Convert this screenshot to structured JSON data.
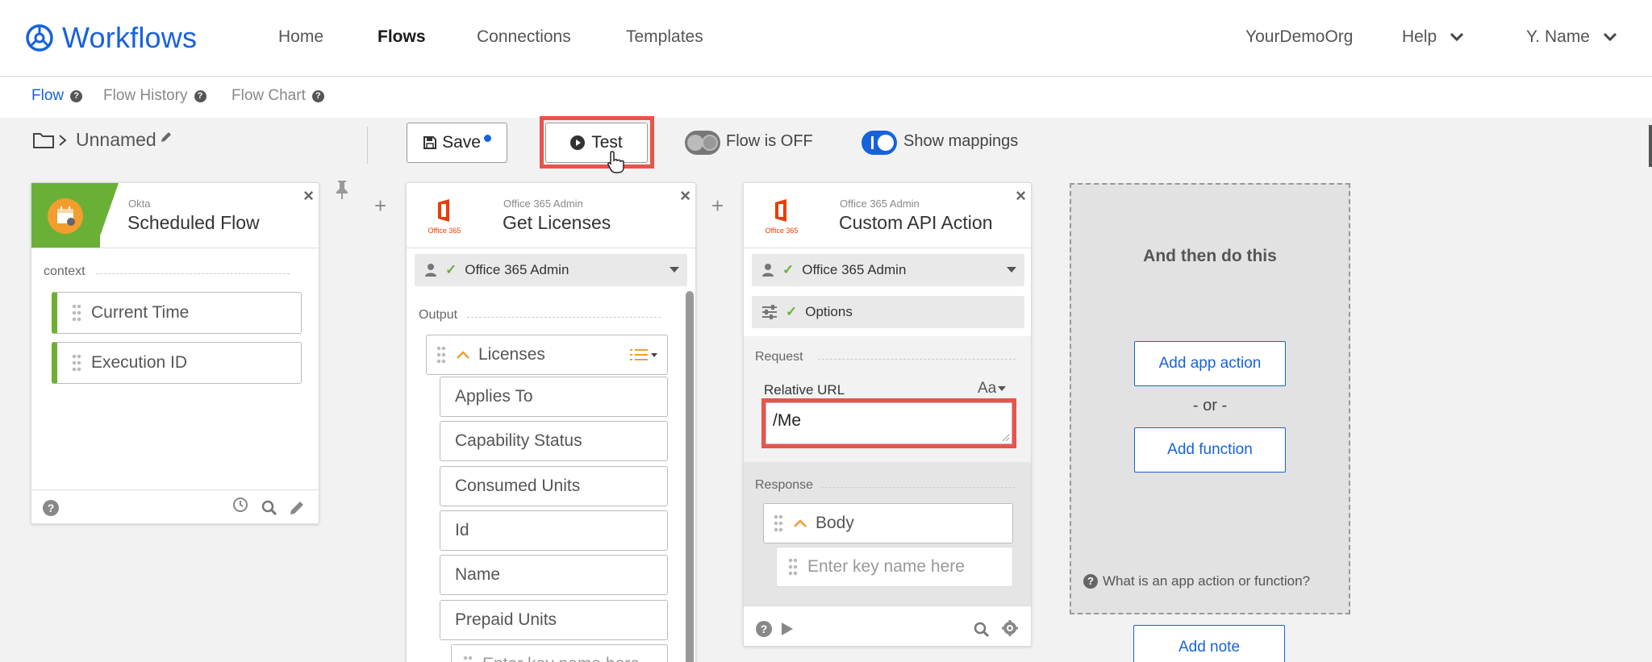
{
  "app": {
    "title": "Workflows"
  },
  "nav": {
    "home": "Home",
    "flows": "Flows",
    "connections": "Connections",
    "templates": "Templates",
    "org": "YourDemoOrg",
    "help": "Help",
    "user": "Y. Name"
  },
  "subtabs": {
    "flow": "Flow",
    "history": "Flow History",
    "chart": "Flow Chart"
  },
  "toolbar": {
    "flow_name": "Unnamed",
    "save": "Save",
    "test": "Test",
    "flow_status": "Flow is OFF",
    "show_mappings": "Show mappings"
  },
  "card1": {
    "app": "Okta",
    "title": "Scheduled Flow",
    "section": "context",
    "fields": [
      "Current Time",
      "Execution ID"
    ]
  },
  "card2": {
    "app": "Office 365 Admin",
    "title": "Get Licenses",
    "connection": "Office 365 Admin",
    "section": "Output",
    "list_label": "Licenses",
    "fields": [
      "Applies To",
      "Capability Status",
      "Consumed Units",
      "Id",
      "Name",
      "Prepaid Units"
    ],
    "placeholder": "Enter key name here"
  },
  "card3": {
    "app": "Office 365 Admin",
    "title": "Custom API Action",
    "connection": "Office 365 Admin",
    "options": "Options",
    "request": "Request",
    "url_label": "Relative URL",
    "text_type": "Aa",
    "url_value": "/Me",
    "response": "Response",
    "body": "Body",
    "placeholder": "Enter key name here"
  },
  "next": {
    "heading": "And then do this",
    "add_app_action": "Add app action",
    "or": "- or -",
    "add_function": "Add function",
    "help": "What is an app action or function?",
    "add_note": "Add note"
  },
  "colors": {
    "accent": "#1662dd",
    "highlight": "#e8544a",
    "green": "#6ab036",
    "office": "#eb3c00",
    "orange": "#f29e2f"
  }
}
